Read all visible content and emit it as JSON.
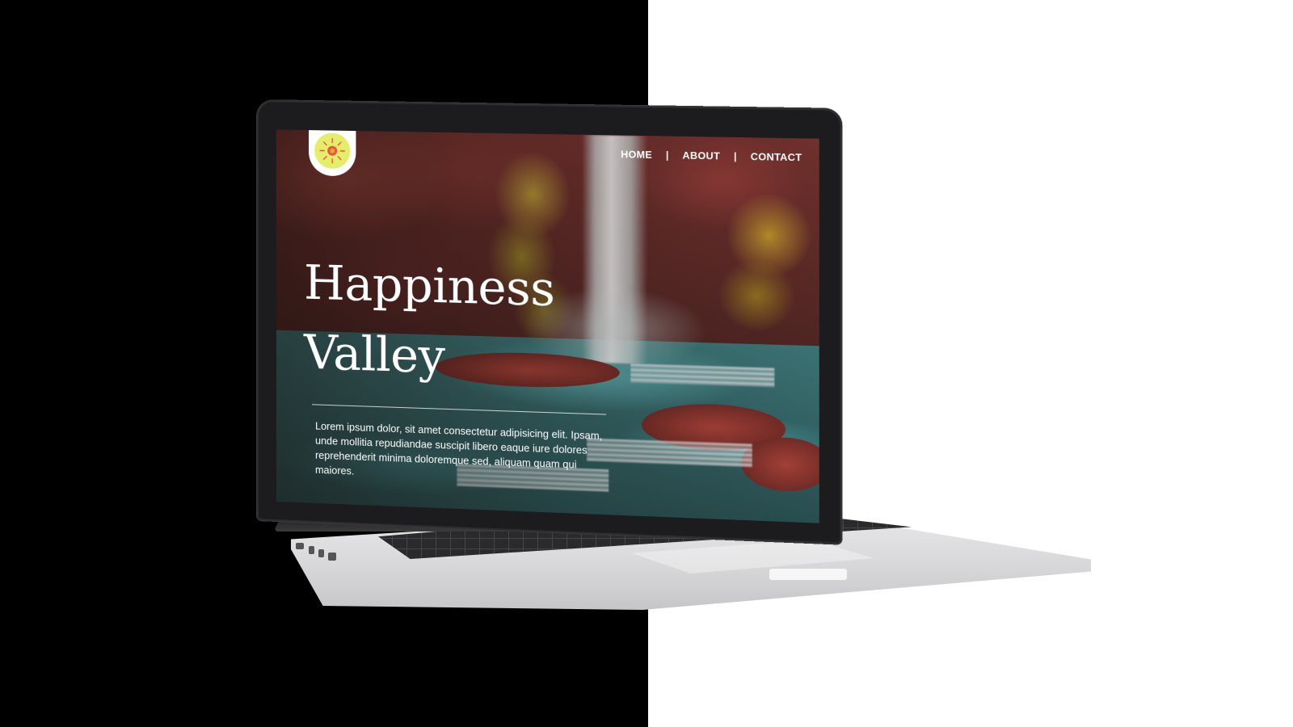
{
  "site": {
    "logo_icon": "sun-icon",
    "nav": {
      "items": [
        {
          "label": "HOME"
        },
        {
          "label": "ABOUT"
        },
        {
          "label": "CONTACT"
        }
      ],
      "separator": "|"
    },
    "hero": {
      "title_line1": "Happiness",
      "title_line2": "Valley",
      "body": "Lorem ipsum dolor, sit amet consectetur adipisicing elit. Ipsam, unde mollitia repudiandae suscipit libero eaque iure dolores reprehenderit minima doloremque sed, aliquam quam qui maiores."
    }
  },
  "colors": {
    "left_background": "#000000",
    "right_background": "#ffffff",
    "logo_fill": "#e4ee6a",
    "logo_accent": "#e8553a",
    "text": "#ffffff"
  }
}
